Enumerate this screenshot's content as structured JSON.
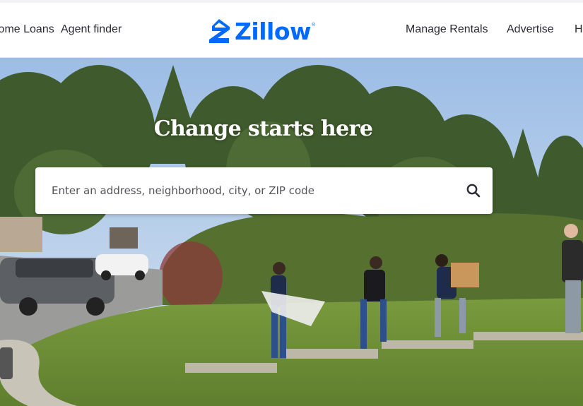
{
  "header": {
    "nav_left": [
      "Home Loans",
      "Agent finder"
    ],
    "nav_right": [
      "Manage Rentals",
      "Advertise",
      "Help"
    ],
    "logo_text": "Zillow",
    "logo_reg": "®"
  },
  "hero": {
    "headline": "Change starts here",
    "search": {
      "placeholder": "Enter an address, neighborhood, city, or ZIP code",
      "value": "",
      "icon": "search-icon"
    }
  },
  "colors": {
    "brand": "#006aff",
    "text": "#2a2a33",
    "grass": "#6d8f3a",
    "sky": "#a9c6e8"
  }
}
